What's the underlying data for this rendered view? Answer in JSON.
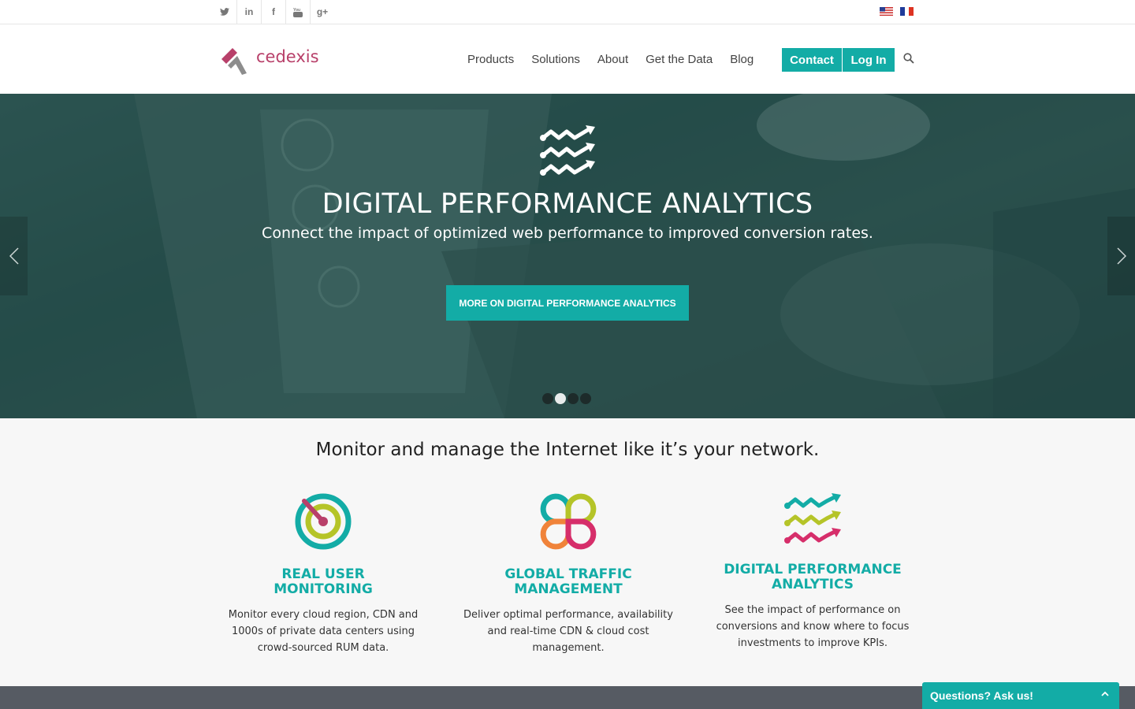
{
  "topbar": {
    "social": [
      {
        "name": "twitter-icon",
        "glyph": "🐦"
      },
      {
        "name": "linkedin-icon",
        "glyph": "in"
      },
      {
        "name": "facebook-icon",
        "glyph": "f"
      },
      {
        "name": "youtube-icon",
        "glyph": "You"
      },
      {
        "name": "google-plus-icon",
        "glyph": "g+"
      }
    ],
    "languages": [
      "English (US flag)",
      "Français (FR flag)"
    ]
  },
  "header": {
    "logo_text": "cedexis",
    "nav": [
      "Products",
      "Solutions",
      "About",
      "Get the Data",
      "Blog"
    ],
    "contact_label": "Contact",
    "login_label": "Log In"
  },
  "hero": {
    "title": "DIGITAL PERFORMANCE ANALYTICS",
    "subtitle": "Connect the impact of optimized web performance to improved conversion rates.",
    "cta_label": "MORE ON DIGITAL PERFORMANCE ANALYTICS",
    "slides": 4,
    "active_slide": 2
  },
  "features": {
    "tagline": "Monitor and manage the Internet like it’s your network.",
    "items": [
      {
        "title": "REAL USER\nMONITORING",
        "desc": "Monitor every cloud region, CDN and 1000s of private data centers using crowd-sourced RUM data."
      },
      {
        "title": "GLOBAL TRAFFIC\nMANAGEMENT",
        "desc": "Deliver optimal performance, availability and real-time CDN & cloud cost management."
      },
      {
        "title": "DIGITAL PERFORMANCE\nANALYTICS",
        "desc": "See the impact of performance on conversions and know where to focus investments to improve KPIs."
      }
    ]
  },
  "chat": {
    "label": "Questions? Ask us!"
  },
  "colors": {
    "accent": "#13aca6",
    "brand": "#b8406a",
    "footer": "#565b63"
  }
}
